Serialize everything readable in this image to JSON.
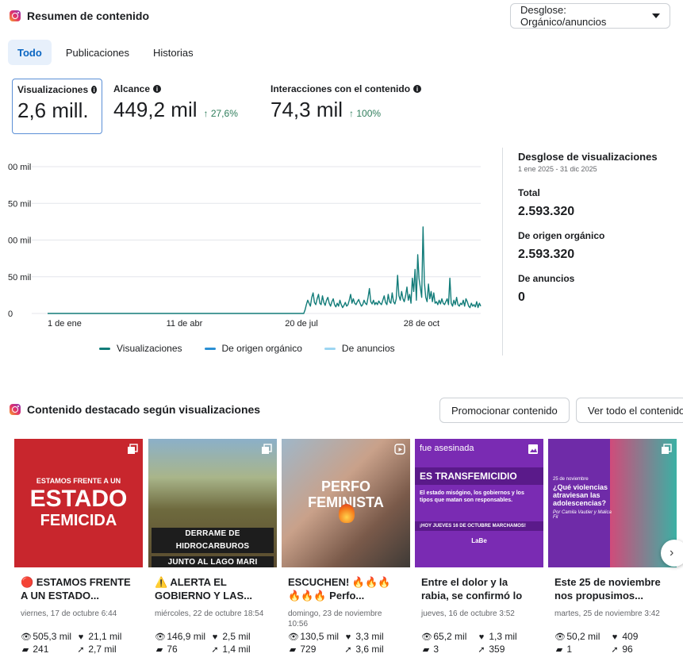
{
  "header": {
    "title": "Resumen de contenido",
    "dropdown_label": "Desglose: Orgánico/anuncios"
  },
  "tabs": [
    {
      "label": "Todo",
      "active": true
    },
    {
      "label": "Publicaciones",
      "active": false
    },
    {
      "label": "Historias",
      "active": false
    }
  ],
  "metrics": {
    "visualizaciones": {
      "label": "Visualizaciones",
      "value": "2,6 mill."
    },
    "alcance": {
      "label": "Alcance",
      "value": "449,2 mil",
      "change": "↑ 27,6%"
    },
    "interacciones": {
      "label": "Interacciones con el contenido",
      "value": "74,3 mil",
      "change": "↑ 100%"
    }
  },
  "colors": {
    "visualizaciones": "#127c79",
    "organico": "#2a8fd4",
    "anuncios": "#9dd6f2",
    "grid": "#e4e6eb",
    "positive": "#2e7d5b"
  },
  "chart_data": {
    "type": "line",
    "x_tick_labels": [
      "1 de ene",
      "11 de abr",
      "20 de jul",
      "28 de oct"
    ],
    "y_tick_labels": [
      "0",
      "50 mil",
      "00 mil",
      "50 mil",
      "00 mil"
    ],
    "ylim": [
      0,
      200000
    ],
    "grid": true,
    "legend_position": "bottom",
    "series": [
      {
        "name": "Visualizaciones",
        "color": "#127c79",
        "values": [
          0,
          0,
          0,
          0,
          0,
          0,
          0,
          0,
          0,
          0,
          0,
          0,
          0,
          0,
          0,
          0,
          0,
          0,
          0,
          0,
          0,
          0,
          0,
          0,
          0,
          0,
          0,
          0,
          0,
          0,
          0,
          0,
          0,
          0,
          0,
          0,
          0,
          0,
          0,
          0,
          0,
          0,
          0,
          0,
          0,
          0,
          0,
          0,
          0,
          0,
          0,
          0,
          0,
          0,
          0,
          0,
          0,
          0,
          0,
          0,
          0,
          0,
          0,
          0,
          0,
          0,
          0,
          0,
          0,
          0,
          0,
          0,
          0,
          0,
          0,
          0,
          0,
          0,
          0,
          0,
          0,
          0,
          0,
          0,
          0,
          0,
          0,
          0,
          0,
          0,
          0,
          0,
          0,
          0,
          0,
          0,
          0,
          0,
          0,
          0,
          0,
          0,
          0,
          0,
          0,
          0,
          0,
          0,
          0,
          0,
          0,
          0,
          0,
          0,
          0,
          0,
          0,
          0,
          0,
          0,
          0,
          0,
          0,
          0,
          0,
          0,
          0,
          0,
          0,
          0,
          0,
          0,
          0,
          0,
          0,
          0,
          0,
          0,
          0,
          0,
          0,
          0,
          0,
          0,
          0,
          0,
          0,
          0,
          0,
          0,
          0,
          0,
          0,
          0,
          0,
          0,
          0,
          0,
          0,
          0,
          0,
          0,
          0,
          0,
          0,
          0,
          0,
          0,
          0,
          0,
          0,
          0,
          0,
          0,
          0,
          0,
          0,
          0,
          0,
          0,
          0,
          0,
          0,
          0,
          0,
          0,
          0,
          0,
          0,
          0,
          0,
          0,
          5000,
          12000,
          18000,
          14000,
          10000,
          22000,
          28000,
          15000,
          12000,
          20000,
          26000,
          14000,
          12000,
          24000,
          15000,
          11000,
          18000,
          22000,
          14000,
          10000,
          16000,
          20000,
          12000,
          9000,
          14000,
          10000,
          18000,
          12000,
          8000,
          11000,
          15000,
          10000,
          12000,
          18000,
          26000,
          14000,
          20000,
          14000,
          12000,
          16000,
          19000,
          14000,
          10000,
          12000,
          18000,
          14000,
          12000,
          22000,
          34000,
          16000,
          13000,
          18000,
          12000,
          15000,
          12000,
          17000,
          14000,
          12000,
          18000,
          24000,
          15000,
          12000,
          26000,
          16000,
          14000,
          28000,
          16000,
          13000,
          20000,
          52000,
          24000,
          18000,
          30000,
          20000,
          16000,
          24000,
          36000,
          18000,
          26000,
          14000,
          48000,
          30000,
          60000,
          18000,
          80000,
          48000,
          35000,
          22000,
          118000,
          42000,
          22000,
          16000,
          40000,
          20000,
          30000,
          16000,
          28000,
          14000,
          16000,
          12000,
          18000,
          13000,
          20000,
          14000,
          12000,
          16000,
          20000,
          12000,
          48000,
          14000,
          10000,
          18000,
          12000,
          22000,
          12000,
          10000,
          14000,
          12000,
          18000,
          10000,
          20000,
          16000,
          10000,
          8000,
          14000,
          10000,
          12000,
          9000,
          16000,
          8000,
          14000,
          10000
        ]
      },
      {
        "name": "De origen orgánico",
        "color": "#2a8fd4",
        "values": []
      },
      {
        "name": "De anuncios",
        "color": "#9dd6f2",
        "values": []
      }
    ]
  },
  "breakdown": {
    "title": "Desglose de visualizaciones",
    "date_range": "1 ene 2025 - 31 dic 2025",
    "total_label": "Total",
    "total_value": "2.593.320",
    "organic_label": "De origen orgánico",
    "organic_value": "2.593.320",
    "ads_label": "De anuncios",
    "ads_value": "0"
  },
  "featured": {
    "title": "Contenido destacado según visualizaciones",
    "promote_label": "Promocionar contenido",
    "view_all_label": "Ver todo el contenido"
  },
  "cards": [
    {
      "overlay": [
        "ESTAMOS FRENTE A UN",
        "ESTADO",
        "FEMICIDA"
      ],
      "title": "🔴 ESTAMOS FRENTE A UN ESTADO...",
      "date": "viernes, 17 de octubre 6:44",
      "views": "505,3 mil",
      "likes": "21,1 mil",
      "comments": "241",
      "shares": "2,7 mil"
    },
    {
      "overlay": [
        "DERRAME DE HIDROCARBUROS",
        "JUNTO AL LAGO MARI MENUCO"
      ],
      "title": "⚠️ ALERTA EL GOBIERNO Y LAS...",
      "date": "miércoles, 22 de octubre 18:54",
      "views": "146,9 mil",
      "likes": "2,5 mil",
      "comments": "76",
      "shares": "1,4 mil"
    },
    {
      "overlay": [
        "PERFO FEMINISTA"
      ],
      "title": "ESCUCHEN! 🔥🔥🔥 🔥🔥🔥 Perfo...",
      "date": "domingo, 23 de noviembre 10:56",
      "views": "130,5 mil",
      "likes": "3,3 mil",
      "comments": "729",
      "shares": "3,6 mil"
    },
    {
      "overlay": [
        "fue asesinada",
        "ES TRANSFEMICIDIO",
        "El estado misógino, los gobiernos y los tipos que matan son responsables.",
        "¡HOY JUEVES 16 DE OCTUBRE MARCHAMOS!",
        "LaBe"
      ],
      "title": "Entre el dolor y la rabia, se confirmó lo que...",
      "date": "jueves, 16 de octubre 3:52",
      "views": "65,2 mil",
      "likes": "1,3 mil",
      "comments": "3",
      "shares": "359"
    },
    {
      "overlay": [
        "25 de noviembre",
        "¿Qué violencias atraviesan las adolescencias?",
        "Por Camila Vautier y Malica Fil"
      ],
      "title": "Este 25 de noviembre nos propusimos...",
      "date": "martes, 25 de noviembre 3:42",
      "views": "50,2 mil",
      "likes": "409",
      "comments": "1",
      "shares": "96"
    }
  ]
}
